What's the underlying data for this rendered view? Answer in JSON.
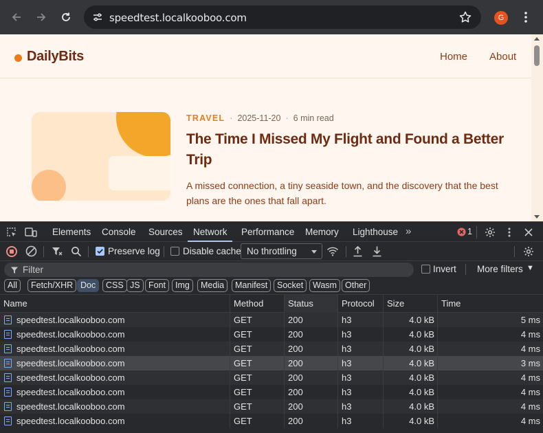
{
  "browser": {
    "url": "speedtest.localkooboo.com",
    "avatar_initial": "G",
    "avatar_color": "#e8521e"
  },
  "site": {
    "logo": "DailyBits",
    "nav": [
      "Home",
      "About"
    ],
    "article": {
      "category": "TRAVEL",
      "date": "2025-11-20",
      "read_time": "6 min read",
      "title": "The Time I Missed My Flight and Found a Better Trip",
      "excerpt": "A missed connection, a tiny seaside town, and the discovery that the best plans are the ones that fall apart."
    },
    "accent_color": "#ea7b1c",
    "title_color": "#6e2b12"
  },
  "devtools": {
    "tabs": [
      "Elements",
      "Console",
      "Sources",
      "Network",
      "Performance",
      "Memory",
      "Lighthouse"
    ],
    "active_tab": "Network",
    "error_count": "1",
    "toolbar": {
      "preserve_log": "Preserve log",
      "preserve_log_checked": true,
      "disable_cache": "Disable cache",
      "disable_cache_checked": false,
      "throttling": "No throttling"
    },
    "filter": {
      "placeholder": "Filter",
      "invert": "Invert",
      "more_filters": "More filters"
    },
    "type_chips": [
      "All",
      "Fetch/XHR",
      "Doc",
      "CSS",
      "JS",
      "Font",
      "Img",
      "Media",
      "Manifest",
      "Socket",
      "Wasm",
      "Other"
    ],
    "selected_chip": "Doc",
    "table": {
      "columns": [
        "Name",
        "Method",
        "Status",
        "Protocol",
        "Size",
        "Time"
      ],
      "rows": [
        [
          "speedtest.localkooboo.com",
          "GET",
          "200",
          "h3",
          "4.0 kB",
          "5 ms"
        ],
        [
          "speedtest.localkooboo.com",
          "GET",
          "200",
          "h3",
          "4.0 kB",
          "4 ms"
        ],
        [
          "speedtest.localkooboo.com",
          "GET",
          "200",
          "h3",
          "4.0 kB",
          "4 ms"
        ],
        [
          "speedtest.localkooboo.com",
          "GET",
          "200",
          "h3",
          "4.0 kB",
          "3 ms"
        ],
        [
          "speedtest.localkooboo.com",
          "GET",
          "200",
          "h3",
          "4.0 kB",
          "4 ms"
        ],
        [
          "speedtest.localkooboo.com",
          "GET",
          "200",
          "h3",
          "4.0 kB",
          "4 ms"
        ],
        [
          "speedtest.localkooboo.com",
          "GET",
          "200",
          "h3",
          "4.0 kB",
          "4 ms"
        ],
        [
          "speedtest.localkooboo.com",
          "GET",
          "200",
          "h3",
          "4.0 kB",
          "4 ms"
        ]
      ],
      "highlighted_row": 4
    }
  }
}
